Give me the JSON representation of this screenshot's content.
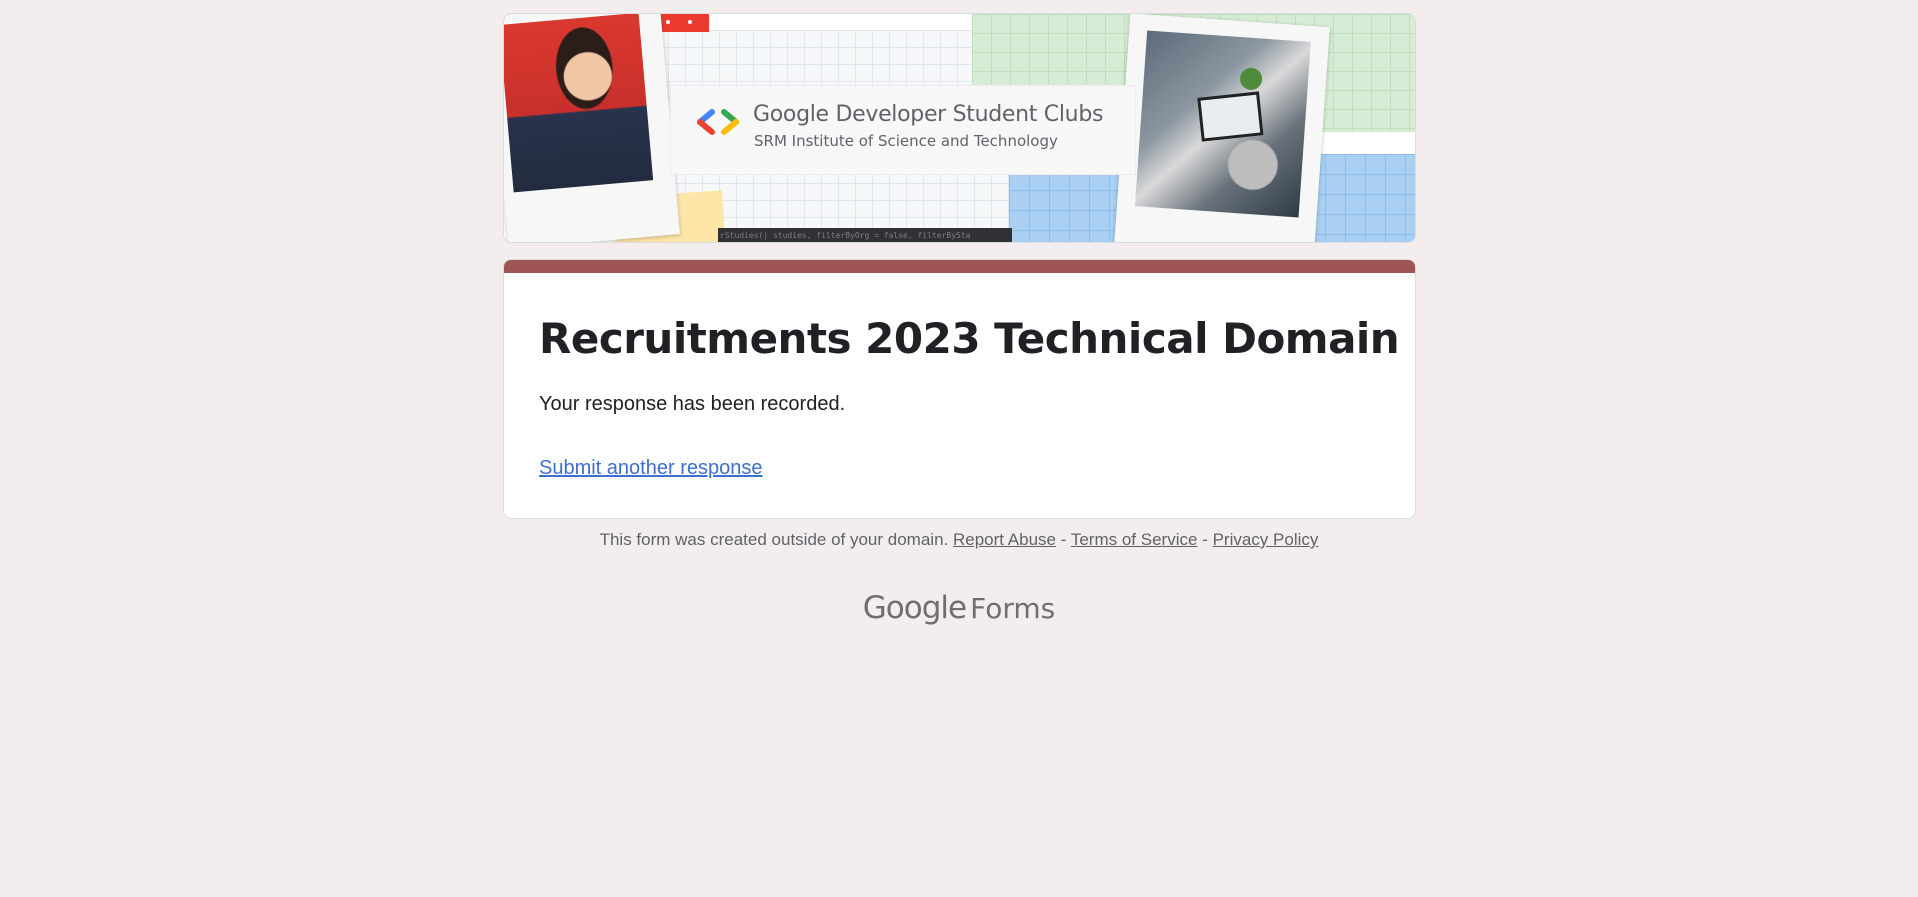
{
  "header": {
    "club_name": "Google Developer Student Clubs",
    "institution": "SRM Institute of Science and Technology",
    "code_snippet": "rStudies(| studies, filterByOrg = false, filterBySta"
  },
  "form": {
    "title": "Recruitments 2023 Technical Domain",
    "confirmation": "Your response has been recorded.",
    "submit_another": "Submit another response",
    "accent_color": "#a05353"
  },
  "footer": {
    "notice": "This form was created outside of your domain.",
    "report_abuse": "Report Abuse",
    "separator": "-",
    "terms": "Terms of Service",
    "privacy": "Privacy Policy"
  },
  "brand": {
    "google": "Google",
    "product": "Forms"
  }
}
